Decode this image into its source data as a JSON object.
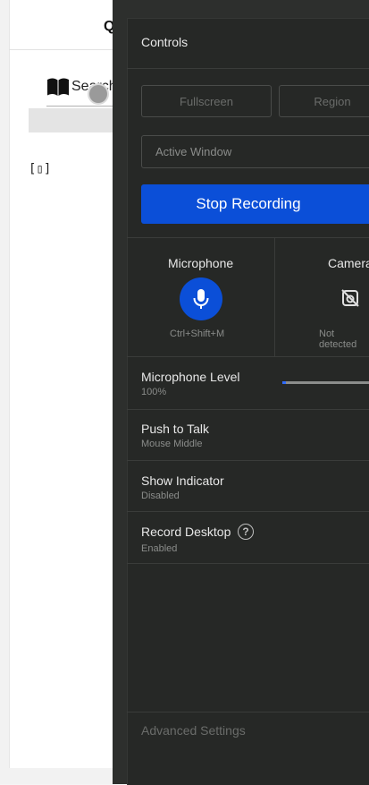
{
  "background": {
    "q_label": "Q",
    "search_text": "Search",
    "glyph_text": "[▯]"
  },
  "panel": {
    "title": "Controls",
    "modes": {
      "fullscreen": "Fullscreen",
      "region": "Region",
      "window": "Active Window"
    },
    "stop_label": "Stop Recording",
    "devices": {
      "microphone": {
        "label": "Microphone",
        "sub": "Ctrl+Shift+M"
      },
      "camera": {
        "label": "Camera",
        "sub": "Not detected"
      }
    },
    "settings": {
      "mic_level": {
        "title": "Microphone Level",
        "value": "100%",
        "fill_fraction": 0.04
      },
      "push_to_talk": {
        "title": "Push to Talk",
        "value": "Mouse Middle"
      },
      "show_indicator": {
        "title": "Show Indicator",
        "value": "Disabled"
      },
      "record_desktop": {
        "title": "Record Desktop",
        "value": "Enabled"
      }
    },
    "advanced_label": "Advanced Settings"
  },
  "colors": {
    "accent": "#0b4fd8",
    "panel_bg": "#262826",
    "text": "#e8e8e8",
    "muted": "#8a8c8a"
  }
}
